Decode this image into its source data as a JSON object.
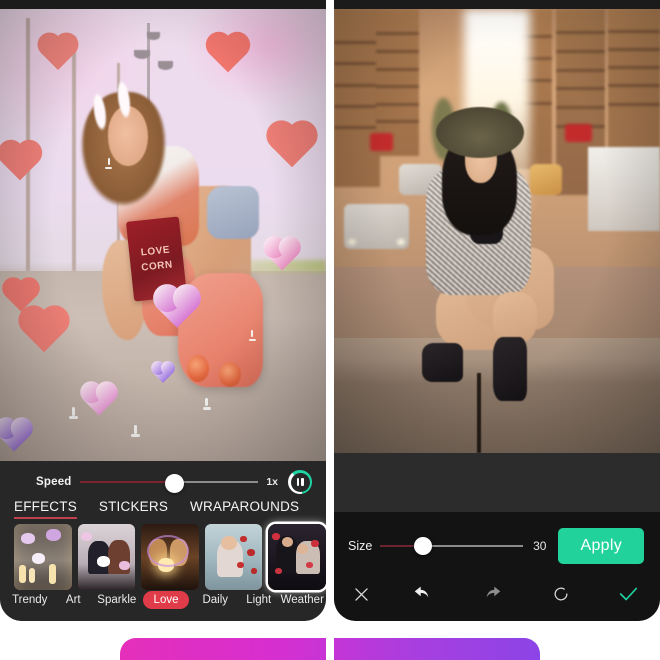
{
  "app": {
    "kind": "mobile-photo-video-editor",
    "panels": [
      "effects-editor",
      "retouch-editor"
    ]
  },
  "left_panel": {
    "photo": {
      "subject": "woman sitting on pavement wearing pink roller skates, holding a red snack pouch",
      "overlay_effect": "pink and white 3D hearts with sparkles",
      "package_line1": "LOVE",
      "package_line2": "CORN"
    },
    "speed": {
      "label": "Speed",
      "value_text": "1x",
      "slider_percent": 53
    },
    "playback": {
      "state_icon": "pause-icon",
      "ring_color": "#1ed6a4"
    },
    "tabs": [
      {
        "label": "EFFECTS",
        "active": true
      },
      {
        "label": "STICKERS",
        "active": false
      },
      {
        "label": "WRAPAROUNDS",
        "active": false
      }
    ],
    "tab_underline_color": "#c0404e",
    "effect_thumbs": [
      {
        "name": "trendy-thumb",
        "art": "candlelit room with pastel hearts"
      },
      {
        "name": "art-thumb",
        "art": "couple in winter coats with hearts"
      },
      {
        "name": "sparkle-thumb",
        "art": "couple with glowing heart"
      },
      {
        "name": "daily-thumb",
        "art": "woman with red petals"
      },
      {
        "name": "weather-thumb",
        "art": "couple embracing with red hearts",
        "selected": true
      }
    ],
    "effect_labels": [
      {
        "text": "Trendy",
        "highlighted": false
      },
      {
        "text": "Art",
        "highlighted": false
      },
      {
        "text": "Sparkle",
        "highlighted": false
      },
      {
        "text": "Love",
        "highlighted": true
      },
      {
        "text": "Daily",
        "highlighted": false
      },
      {
        "text": "Light",
        "highlighted": false
      },
      {
        "text": "Weather",
        "highlighted": false
      }
    ],
    "highlight_pill_color": "#e03b48"
  },
  "right_panel": {
    "photo": {
      "subject": "woman with wide-brim hat sitting on a street curb at golden hour",
      "background": "blurred city street with cars and high-rise buildings"
    },
    "size": {
      "label": "Size",
      "value_text": "30",
      "slider_percent": 30
    },
    "apply_button": {
      "label": "Apply",
      "color": "#21d39a"
    },
    "action_icons": [
      {
        "name": "close-icon",
        "glyph": "close",
        "enabled": true
      },
      {
        "name": "undo-icon",
        "glyph": "undo",
        "enabled": true
      },
      {
        "name": "redo-icon",
        "glyph": "redo",
        "enabled": false
      },
      {
        "name": "reset-icon",
        "glyph": "reset-circle",
        "enabled": true
      },
      {
        "name": "confirm-check-icon",
        "glyph": "check",
        "enabled": true,
        "color": "#1fd3a0"
      }
    ]
  },
  "bottom_strip": {
    "gradient_from": "#e42fba",
    "gradient_to": "#8c44e6"
  }
}
